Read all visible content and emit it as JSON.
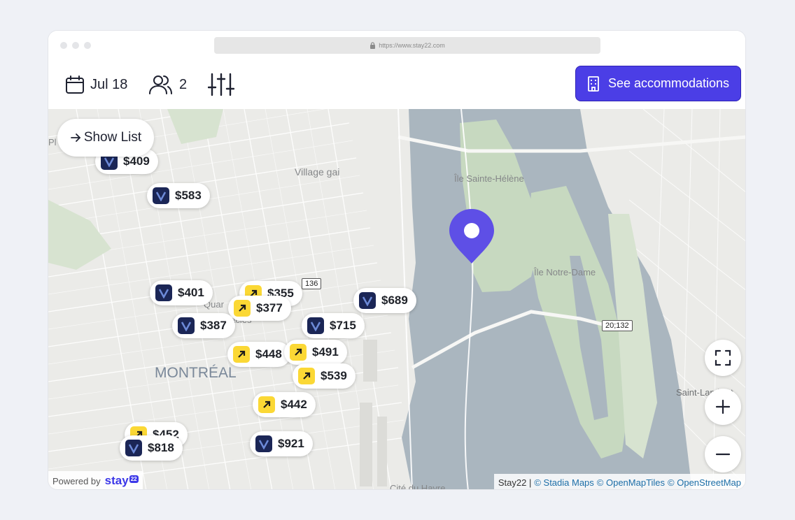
{
  "browser": {
    "url": "https://www.stay22.com"
  },
  "toolbar": {
    "date_label": "Jul 18",
    "guests_count": "2",
    "see_button_label": "See accommodations"
  },
  "map": {
    "show_list_label": "Show List",
    "place_labels": {
      "village_gai": "Village gai",
      "ile_sainte_helene": "Île Sainte-Hélène",
      "ile_notre_dame": "Île Notre-Dame",
      "montreal": "MONTRÉAL",
      "saint_lambert": "Saint-Lambert",
      "cite_du_havre": "Cité du Havre",
      "quartier": "Quar",
      "spectacles": "ctacles",
      "edge_p": "Pl"
    },
    "route_shields": {
      "r136": "136",
      "r20_132": "20;132"
    },
    "listings": [
      {
        "provider": "vrbo",
        "price": "$409"
      },
      {
        "provider": "vrbo",
        "price": "$583"
      },
      {
        "provider": "expedia",
        "price": "$355"
      },
      {
        "provider": "vrbo",
        "price": "$401"
      },
      {
        "provider": "expedia",
        "price": "$377"
      },
      {
        "provider": "vrbo",
        "price": "$689"
      },
      {
        "provider": "vrbo",
        "price": "$387"
      },
      {
        "provider": "vrbo",
        "price": "$715"
      },
      {
        "provider": "expedia",
        "price": "$448"
      },
      {
        "provider": "expedia",
        "price": "$491"
      },
      {
        "provider": "expedia",
        "price": "$539"
      },
      {
        "provider": "expedia",
        "price": "$442"
      },
      {
        "provider": "expedia",
        "price": "$452"
      },
      {
        "provider": "vrbo",
        "price": "$818"
      },
      {
        "provider": "vrbo",
        "price": "$921"
      }
    ],
    "powered_by": "Powered by",
    "brand": "stay",
    "brand_badge": "22",
    "attribution": {
      "prefix": "Stay22 |",
      "stadia": "© Stadia Maps",
      "omt": "© OpenMapTiles",
      "osm": "© OpenStreetMap"
    }
  },
  "colors": {
    "accent": "#4b3ee6",
    "pin": "#5e4fe6",
    "vrbo_logo": "#1b2656",
    "expedia_logo": "#fbd835",
    "water": "#aab6bf",
    "park": "#c7d9c0"
  },
  "icons": {
    "calendar": "calendar-icon",
    "guests": "users-icon",
    "filters": "sliders-icon",
    "building": "building-icon",
    "arrow": "arrow-right-icon",
    "fullscreen": "fullscreen-icon",
    "zoom_in": "plus-icon",
    "zoom_out": "minus-icon",
    "pin": "location-pin-icon"
  }
}
